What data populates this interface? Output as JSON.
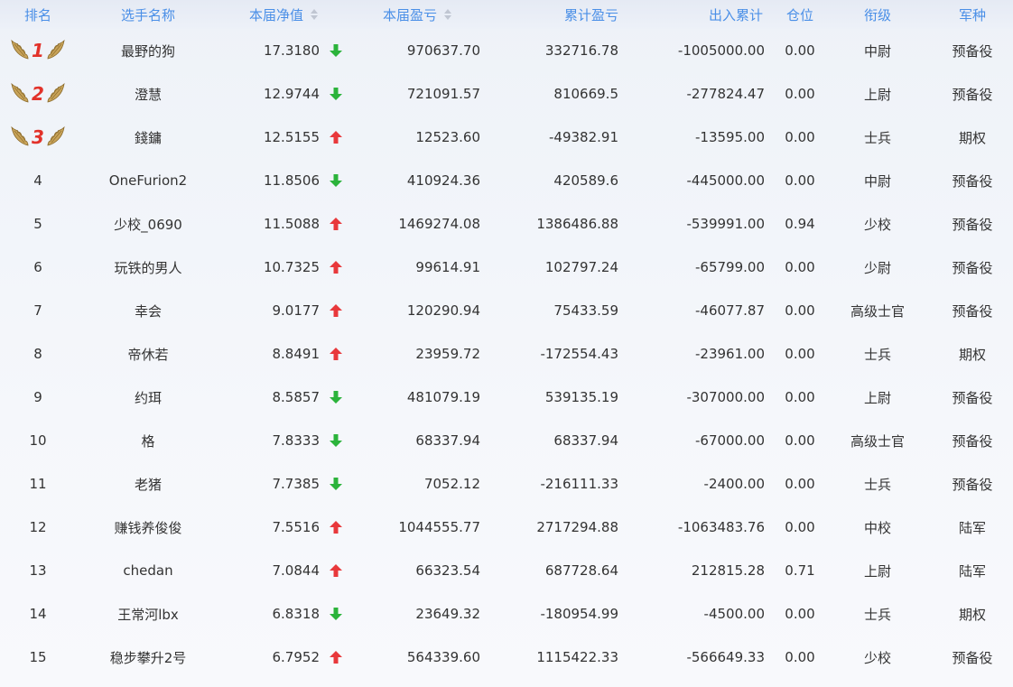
{
  "header": {
    "rank": "排名",
    "name": "选手名称",
    "nav": "本届净值",
    "profit": "本届盈亏",
    "cum_profit": "累计盈亏",
    "flow": "出入累计",
    "position": "仓位",
    "title": "衔级",
    "army": "军种"
  },
  "colors": {
    "accent": "#4a8fe7",
    "up": "#e8383b",
    "down": "#2bb33b",
    "medal_text": "#e2322a",
    "wing": "#c9a45a"
  },
  "rows": [
    {
      "rank": "1",
      "medal": true,
      "name": "最野的狗",
      "nav": "17.3180",
      "trend": "down",
      "profit": "970637.70",
      "cum": "332716.78",
      "flow": "-1005000.00",
      "pos": "0.00",
      "title": "中尉",
      "army": "预备役"
    },
    {
      "rank": "2",
      "medal": true,
      "name": "澄慧",
      "nav": "12.9744",
      "trend": "down",
      "profit": "721091.57",
      "cum": "810669.5",
      "flow": "-277824.47",
      "pos": "0.00",
      "title": "上尉",
      "army": "预备役"
    },
    {
      "rank": "3",
      "medal": true,
      "name": "錢鏞",
      "nav": "12.5155",
      "trend": "up",
      "profit": "12523.60",
      "cum": "-49382.91",
      "flow": "-13595.00",
      "pos": "0.00",
      "title": "士兵",
      "army": "期权"
    },
    {
      "rank": "4",
      "medal": false,
      "name": "OneFurion2",
      "nav": "11.8506",
      "trend": "down",
      "profit": "410924.36",
      "cum": "420589.6",
      "flow": "-445000.00",
      "pos": "0.00",
      "title": "中尉",
      "army": "预备役"
    },
    {
      "rank": "5",
      "medal": false,
      "name": "少校_0690",
      "nav": "11.5088",
      "trend": "up",
      "profit": "1469274.08",
      "cum": "1386486.88",
      "flow": "-539991.00",
      "pos": "0.94",
      "title": "少校",
      "army": "预备役"
    },
    {
      "rank": "6",
      "medal": false,
      "name": "玩铁的男人",
      "nav": "10.7325",
      "trend": "up",
      "profit": "99614.91",
      "cum": "102797.24",
      "flow": "-65799.00",
      "pos": "0.00",
      "title": "少尉",
      "army": "预备役"
    },
    {
      "rank": "7",
      "medal": false,
      "name": "幸会",
      "nav": "9.0177",
      "trend": "up",
      "profit": "120290.94",
      "cum": "75433.59",
      "flow": "-46077.87",
      "pos": "0.00",
      "title": "高级士官",
      "army": "预备役"
    },
    {
      "rank": "8",
      "medal": false,
      "name": "帝休若",
      "nav": "8.8491",
      "trend": "up",
      "profit": "23959.72",
      "cum": "-172554.43",
      "flow": "-23961.00",
      "pos": "0.00",
      "title": "士兵",
      "army": "期权"
    },
    {
      "rank": "9",
      "medal": false,
      "name": "约珥",
      "nav": "8.5857",
      "trend": "down",
      "profit": "481079.19",
      "cum": "539135.19",
      "flow": "-307000.00",
      "pos": "0.00",
      "title": "上尉",
      "army": "预备役"
    },
    {
      "rank": "10",
      "medal": false,
      "name": "格",
      "nav": "7.8333",
      "trend": "down",
      "profit": "68337.94",
      "cum": "68337.94",
      "flow": "-67000.00",
      "pos": "0.00",
      "title": "高级士官",
      "army": "预备役"
    },
    {
      "rank": "11",
      "medal": false,
      "name": "老猪",
      "nav": "7.7385",
      "trend": "down",
      "profit": "7052.12",
      "cum": "-216111.33",
      "flow": "-2400.00",
      "pos": "0.00",
      "title": "士兵",
      "army": "预备役"
    },
    {
      "rank": "12",
      "medal": false,
      "name": "赚钱养俊俊",
      "nav": "7.5516",
      "trend": "up",
      "profit": "1044555.77",
      "cum": "2717294.88",
      "flow": "-1063483.76",
      "pos": "0.00",
      "title": "中校",
      "army": "陆军"
    },
    {
      "rank": "13",
      "medal": false,
      "name": "chedan",
      "nav": "7.0844",
      "trend": "up",
      "profit": "66323.54",
      "cum": "687728.64",
      "flow": "212815.28",
      "pos": "0.71",
      "title": "上尉",
      "army": "陆军"
    },
    {
      "rank": "14",
      "medal": false,
      "name": "王常河lbx",
      "nav": "6.8318",
      "trend": "down",
      "profit": "23649.32",
      "cum": "-180954.99",
      "flow": "-4500.00",
      "pos": "0.00",
      "title": "士兵",
      "army": "期权"
    },
    {
      "rank": "15",
      "medal": false,
      "name": "稳步攀升2号",
      "nav": "6.7952",
      "trend": "up",
      "profit": "564339.60",
      "cum": "1115422.33",
      "flow": "-566649.33",
      "pos": "0.00",
      "title": "少校",
      "army": "预备役"
    }
  ]
}
